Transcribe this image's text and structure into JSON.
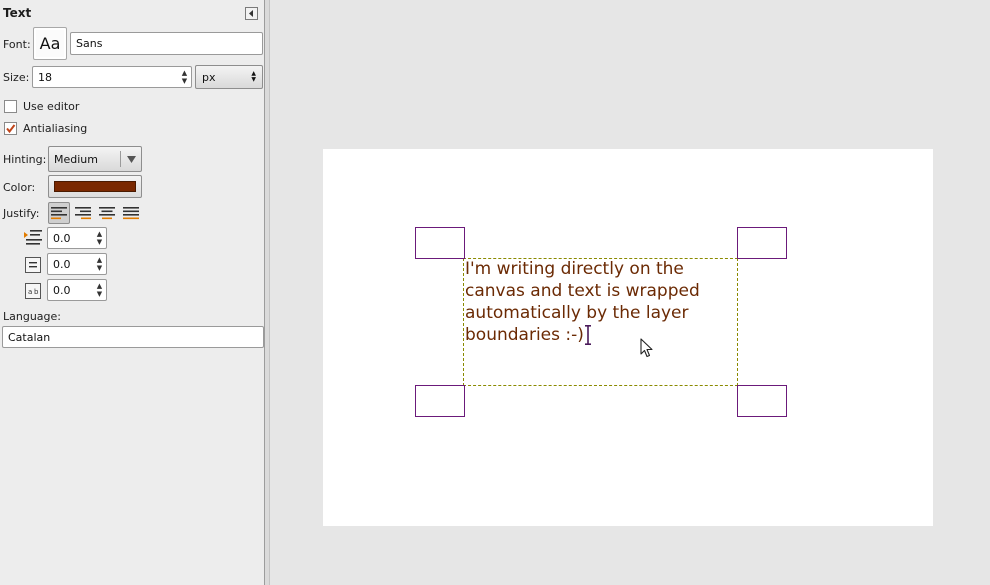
{
  "panel": {
    "title": "Text",
    "font": {
      "label": "Font:",
      "preview": "Aa",
      "value": "Sans"
    },
    "size": {
      "label": "Size:",
      "value": "18",
      "unit": "px"
    },
    "use_editor": {
      "label": "Use editor",
      "checked": false
    },
    "antialiasing": {
      "label": "Antialiasing",
      "checked": true
    },
    "hinting": {
      "label": "Hinting:",
      "value": "Medium"
    },
    "color": {
      "label": "Color:",
      "value": "#7a2800"
    },
    "justify": {
      "label": "Justify:",
      "options": [
        "justify-left",
        "justify-right",
        "justify-center",
        "justify-fill"
      ],
      "selected": "justify-left"
    },
    "indent": {
      "value": "0.0"
    },
    "line_spacing": {
      "value": "0.0"
    },
    "letter_spacing": {
      "value": "0.0"
    },
    "language": {
      "label": "Language:",
      "value": "Catalan"
    }
  },
  "canvas": {
    "text": "I'm writing directly on the\ncanvas and text is wrapped\nautomatically by the layer\nboundaries :-)",
    "text_color": "#6b2a04"
  }
}
